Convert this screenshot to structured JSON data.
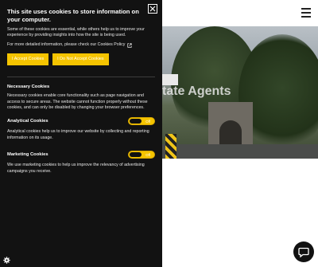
{
  "site": {
    "hero_title": "tate Agents"
  },
  "cookie_banner": {
    "title": "This site uses cookies to store information on your computer.",
    "intro": "Some of these cookies are essential, while others help us to improve your experience by providing insights into how the site is being used.",
    "policy_text": "For more detailed information, please check our Cookies Policy",
    "accept_label": "I Accept Cookies",
    "decline_label": "I Do Not Accept Cookies",
    "sections": {
      "necessary": {
        "title": "Necessary Cookies",
        "text": "Necessary cookies enable core functionality such as page navigation and access to secure areas. The website cannot function properly without these cookies, and can only be disabled by changing your browser preferences."
      },
      "analytical": {
        "title": "Analytical Cookies",
        "text": "Analytical cookies help us to improve our website by collecting and reporting information on its usage.",
        "toggle_state": "Off"
      },
      "marketing": {
        "title": "Marketing Cookies",
        "text": "We use marketing cookies to help us improve the relevancy of advertising campaigns you receive.",
        "toggle_state": "Off"
      }
    }
  },
  "colors": {
    "panel_bg": "#121212",
    "accent": "#f5c400"
  },
  "icons": [
    "close-icon",
    "external-link-icon",
    "menu-icon",
    "chat-icon",
    "cookie-settings-icon"
  ]
}
